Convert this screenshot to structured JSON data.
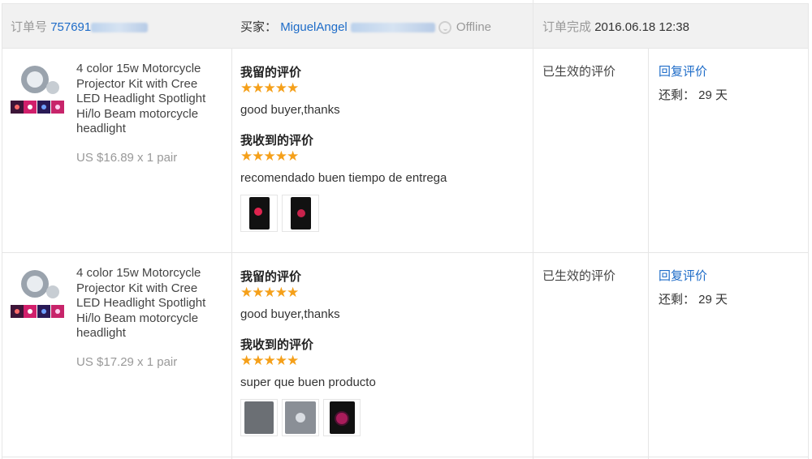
{
  "header": {
    "order_label": "订单号",
    "order_number": "757691",
    "buyer_label": "买家：",
    "buyer_name": "MiguelAngel",
    "buyer_status": "Offline",
    "complete_label": "订单完成",
    "complete_time": "2016.06.18 12:38"
  },
  "orders": [
    {
      "product_title": "4 color 15w Motorcycle Projector Kit with Cree LED Headlight Spotlight Hi/lo Beam motorcycle headlight",
      "price": "US $16.89 x 1 pair",
      "my_review_label": "我留的评价",
      "my_stars": 5,
      "my_review": "good buyer,thanks",
      "received_label": "我收到的评价",
      "received_stars": 5,
      "received_review": "recomendado buen tiempo de entrega",
      "status": "已生效的评价",
      "reply": "回复评价",
      "remaining": "还剩： 29 天"
    },
    {
      "product_title": "4 color 15w Motorcycle Projector Kit with Cree LED Headlight Spotlight Hi/lo Beam motorcycle headlight",
      "price": "US $17.29 x 1 pair",
      "my_review_label": "我留的评价",
      "my_stars": 5,
      "my_review": "good buyer,thanks",
      "received_label": "我收到的评价",
      "received_stars": 5,
      "received_review": "super que buen producto",
      "status": "已生效的评价",
      "reply": "回复评价",
      "remaining": "还剩： 29 天"
    }
  ],
  "colors": {
    "link": "#1e6cc8",
    "star": "#f5a01a",
    "header_bg": "#f1f1f1"
  }
}
